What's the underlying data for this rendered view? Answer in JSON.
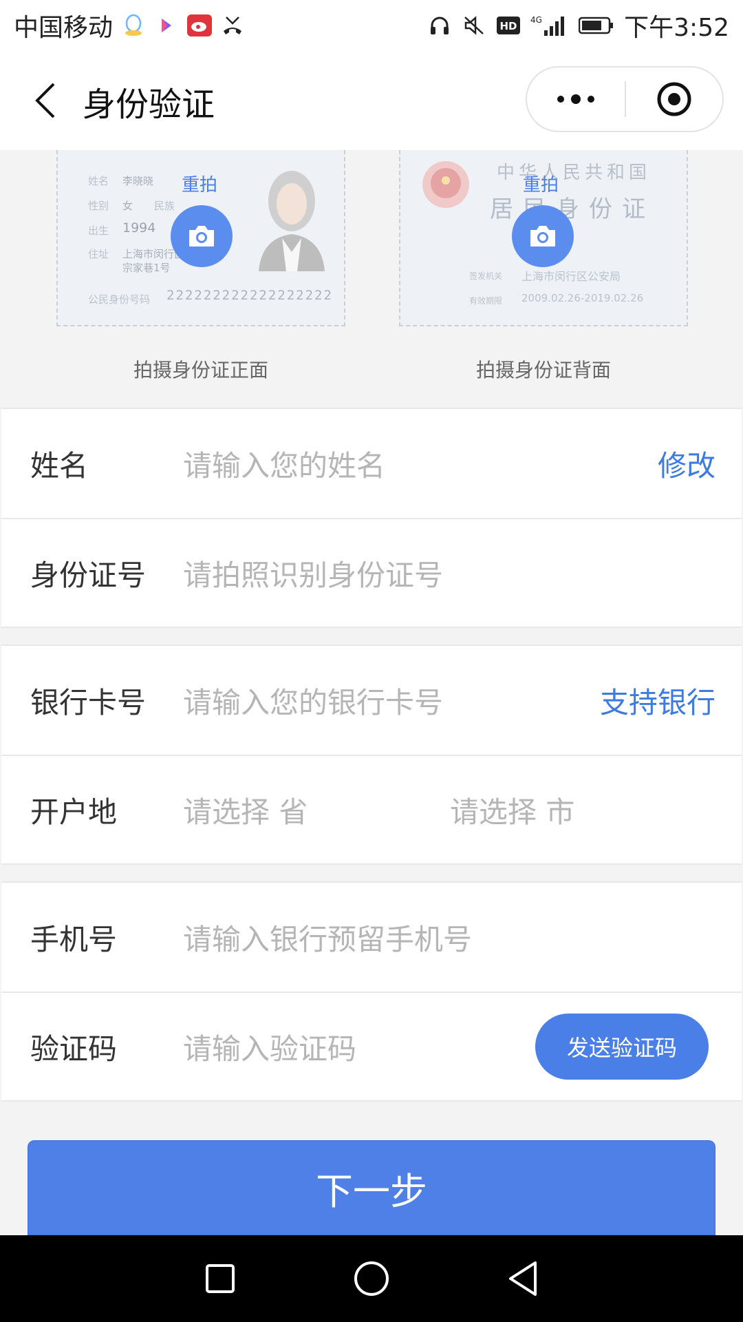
{
  "status_bar": {
    "carrier": "中国移动",
    "network": "4G",
    "time": "下午3:52",
    "icons": [
      "qq-icon",
      "video-app-icon",
      "weibo-icon",
      "missed-call-icon",
      "headphones-icon",
      "mute-icon",
      "hd-icon",
      "signal-icon",
      "battery-icon"
    ]
  },
  "navbar": {
    "title": "身份验证",
    "back_icon": "chevron-left-icon",
    "more_icon": "more-dots-icon",
    "close_icon": "target-circle-icon"
  },
  "id_cards": {
    "front": {
      "retake_label": "重拍",
      "caption": "拍摄身份证正面",
      "fields": {
        "name_label": "姓名",
        "name_value": "李晓晓",
        "sex_label": "性别",
        "sex_value": "女",
        "ethnic_label": "民族",
        "birth_label": "出生",
        "birth_value": "1994",
        "address_label": "住址",
        "address_line1": "上海市闵行区",
        "address_line2": "宗家巷1号",
        "id_label": "公民身份号码",
        "id_number": "222222222222222222"
      }
    },
    "back": {
      "retake_label": "重拍",
      "caption": "拍摄身份证背面",
      "fields": {
        "country": "中华人民共和国",
        "card_title": "居民身份证",
        "authority_label": "签发机关",
        "authority_value": "上海市闵行区公安局",
        "validity_label": "有效期限",
        "validity_value": "2009.02.26-2019.02.26"
      }
    }
  },
  "form": {
    "group1": [
      {
        "label": "姓名",
        "placeholder": "请输入您的姓名",
        "action": "修改"
      },
      {
        "label": "身份证号",
        "placeholder": "请拍照识别身份证号"
      }
    ],
    "group2": [
      {
        "label": "银行卡号",
        "placeholder": "请输入您的银行卡号",
        "action": "支持银行"
      },
      {
        "label": "开户地",
        "province_placeholder": "请选择 省",
        "city_placeholder": "请选择 市"
      }
    ],
    "group3": [
      {
        "label": "手机号",
        "placeholder": "请输入银行预留手机号"
      },
      {
        "label": "验证码",
        "placeholder": "请输入验证码",
        "button": "发送验证码"
      }
    ]
  },
  "next_button": "下一步",
  "colors": {
    "accent": "#4e80e8",
    "link": "#3c7be0",
    "placeholder": "#b5b5b5",
    "background": "#f3f3f3"
  }
}
